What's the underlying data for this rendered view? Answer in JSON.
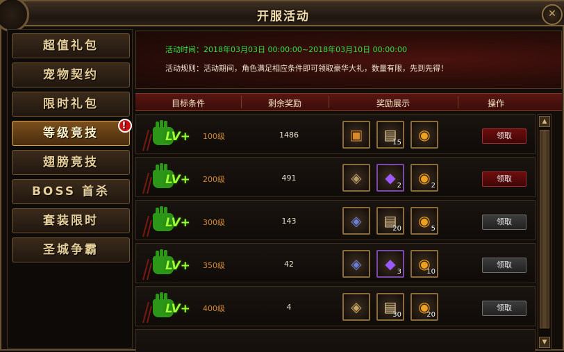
{
  "window": {
    "title": "开服活动",
    "close_glyph": "✕"
  },
  "sidebar": {
    "items": [
      {
        "label": "超值礼包",
        "active": false
      },
      {
        "label": "宠物契约",
        "active": false
      },
      {
        "label": "限时礼包",
        "active": false
      },
      {
        "label": "等级竞技",
        "active": true,
        "badge": "!"
      },
      {
        "label": "翅膀竞技",
        "active": false
      },
      {
        "label": "BOSS 首杀",
        "active": false
      },
      {
        "label": "套装限时",
        "active": false
      },
      {
        "label": "圣城争霸",
        "active": false
      }
    ]
  },
  "banner": {
    "time_label": "活动时间：",
    "time_value": "2018年03月03日  00:00:00~2018年03月10日  00:00:00",
    "rule_text": "活动规则：活动期间，角色满足相应条件即可领取豪华大礼，数量有限，先到先得！"
  },
  "table": {
    "headers": [
      "目标条件",
      "剩余奖励",
      "奖励展示",
      "操作"
    ],
    "lv_badge": "LV+",
    "claim_label": "领取",
    "rows": [
      {
        "level": "100级",
        "remain": "1486",
        "claim_style": "red",
        "rewards": [
          {
            "icon": "chest-icon",
            "count": ""
          },
          {
            "icon": "scroll-icon",
            "count": "15"
          },
          {
            "icon": "gold-coin-icon",
            "count": ""
          }
        ]
      },
      {
        "level": "200级",
        "remain": "491",
        "claim_style": "red",
        "rewards": [
          {
            "icon": "boots-icon",
            "count": ""
          },
          {
            "icon": "purple-crystal-icon",
            "count": "2"
          },
          {
            "icon": "gold-coin-icon",
            "count": "2"
          }
        ]
      },
      {
        "level": "300级",
        "remain": "143",
        "claim_style": "gray",
        "rewards": [
          {
            "icon": "armor-icon",
            "count": ""
          },
          {
            "icon": "scroll-icon",
            "count": "20"
          },
          {
            "icon": "gold-coin-icon",
            "count": "5"
          }
        ]
      },
      {
        "level": "350级",
        "remain": "42",
        "claim_style": "gray",
        "rewards": [
          {
            "icon": "armor-icon",
            "count": ""
          },
          {
            "icon": "purple-crystal-icon",
            "count": "3"
          },
          {
            "icon": "gold-coin-icon",
            "count": "10"
          }
        ]
      },
      {
        "level": "400级",
        "remain": "4",
        "claim_style": "gray",
        "rewards": [
          {
            "icon": "helmet-icon",
            "count": ""
          },
          {
            "icon": "scroll-icon",
            "count": "30"
          },
          {
            "icon": "gold-coin-icon",
            "count": "20"
          }
        ]
      }
    ]
  },
  "colors": {
    "accent_gold": "#e6cf9a",
    "time_green": "#33e04a",
    "level_orange": "#d28a3a",
    "header_red": "#5a1612"
  }
}
